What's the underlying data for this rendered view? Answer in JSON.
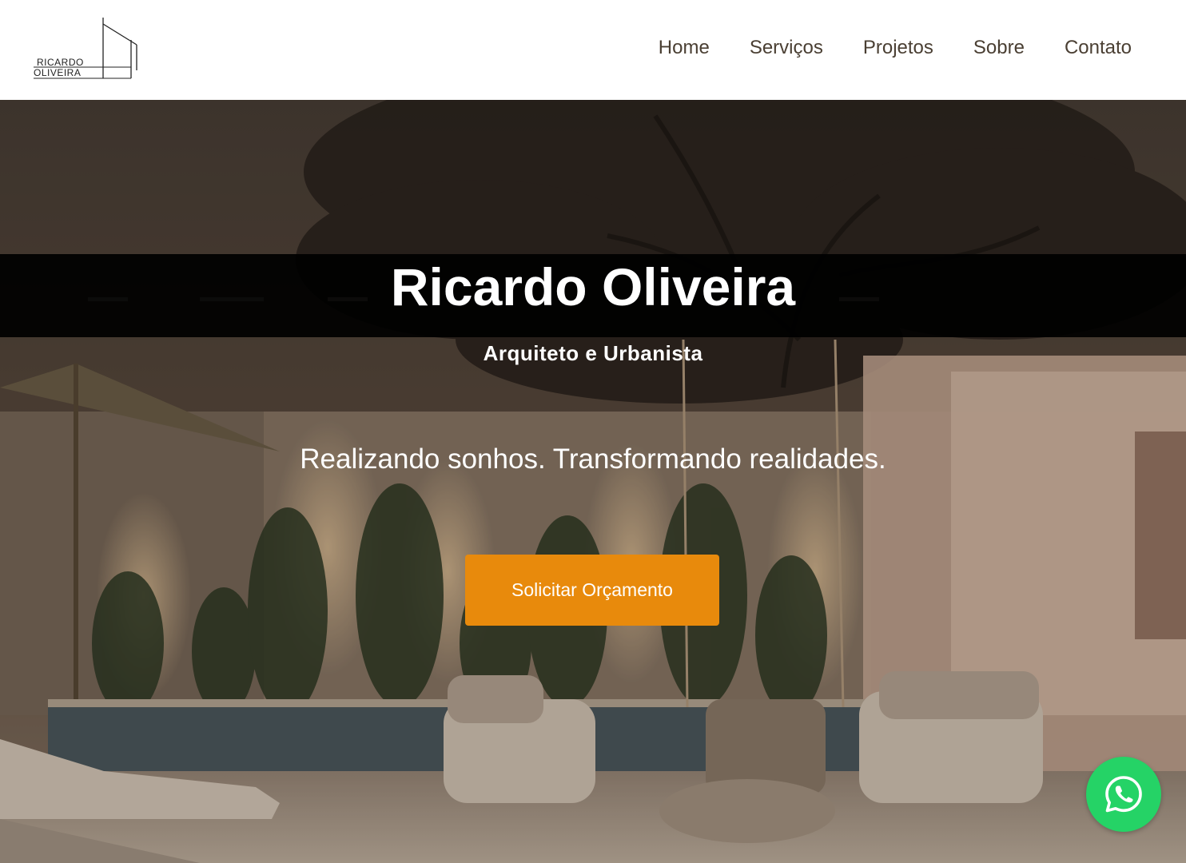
{
  "logo": {
    "line1": "RICARDO",
    "line2": "OLIVEIRA"
  },
  "nav": {
    "items": [
      {
        "label": "Home"
      },
      {
        "label": "Serviços"
      },
      {
        "label": "Projetos"
      },
      {
        "label": "Sobre"
      },
      {
        "label": "Contato"
      }
    ]
  },
  "hero": {
    "title": "Ricardo Oliveira",
    "subtitle": "Arquiteto e Urbanista",
    "tagline": "Realizando sonhos. Transformando realidades.",
    "cta_label": "Solicitar Orçamento"
  },
  "whatsapp": {
    "icon": "whatsapp-icon"
  },
  "colors": {
    "accent": "#e88a0c",
    "whatsapp": "#25d366",
    "nav_text": "#4a3f33"
  }
}
